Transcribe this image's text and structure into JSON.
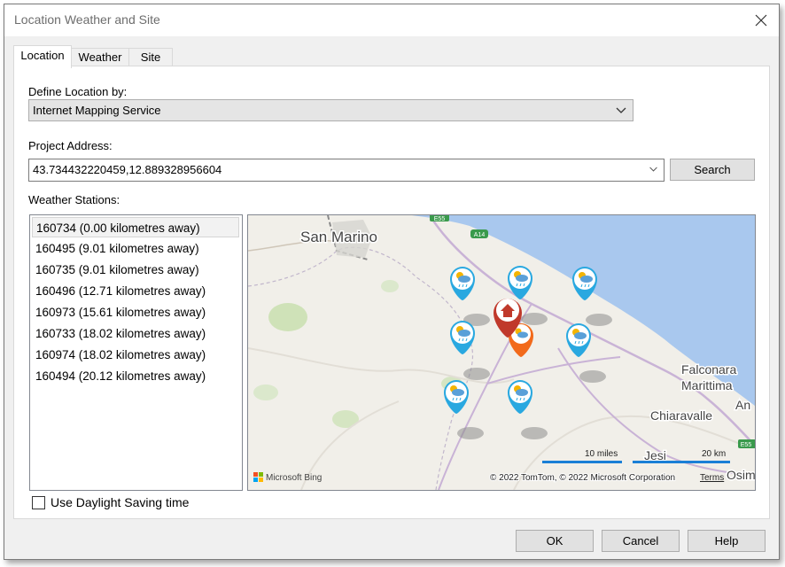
{
  "window": {
    "title": "Location Weather and Site"
  },
  "tabs": [
    {
      "label": "Location",
      "active": true
    },
    {
      "label": "Weather",
      "active": false
    },
    {
      "label": "Site",
      "active": false
    }
  ],
  "location": {
    "define_label": "Define Location by:",
    "define_value": "Internet Mapping Service",
    "address_label": "Project Address:",
    "address_value": "43.734432220459,12.889328956604",
    "search_label": "Search",
    "stations_label": "Weather Stations:",
    "stations": [
      "160734 (0.00 kilometres away)",
      "160495 (9.01 kilometres away)",
      "160735 (9.01 kilometres away)",
      "160496 (12.71 kilometres away)",
      "160973 (15.61 kilometres away)",
      "160733 (18.02 kilometres away)",
      "160974 (18.02 kilometres away)",
      "160494 (20.12 kilometres away)"
    ],
    "daylight_label": "Use Daylight Saving time",
    "daylight_checked": false
  },
  "map": {
    "places": {
      "san_marino": "San Marino",
      "falconara": "Falconara",
      "marittima": "Marittima",
      "chiaravalle": "Chiaravalle",
      "ancona_fragment": "An",
      "jesi_fragment": "Jesi",
      "osimo_fragment": "Osim"
    },
    "road_labels": {
      "e55_top": "E55",
      "a14": "A14",
      "e55_right": "E55"
    },
    "scale_miles": "10 miles",
    "scale_km": "20 km",
    "attribution": "© 2022 TomTom, © 2022 Microsoft Corporation",
    "terms": "Terms",
    "provider": "Microsoft Bing",
    "colors": {
      "water": "#a9c8ee",
      "land": "#f1efe9",
      "station_pin": "#29a8e0",
      "site_pin": "#c0392b",
      "selected_pin": "#f26a1b"
    }
  },
  "footer": {
    "ok": "OK",
    "cancel": "Cancel",
    "help": "Help"
  }
}
